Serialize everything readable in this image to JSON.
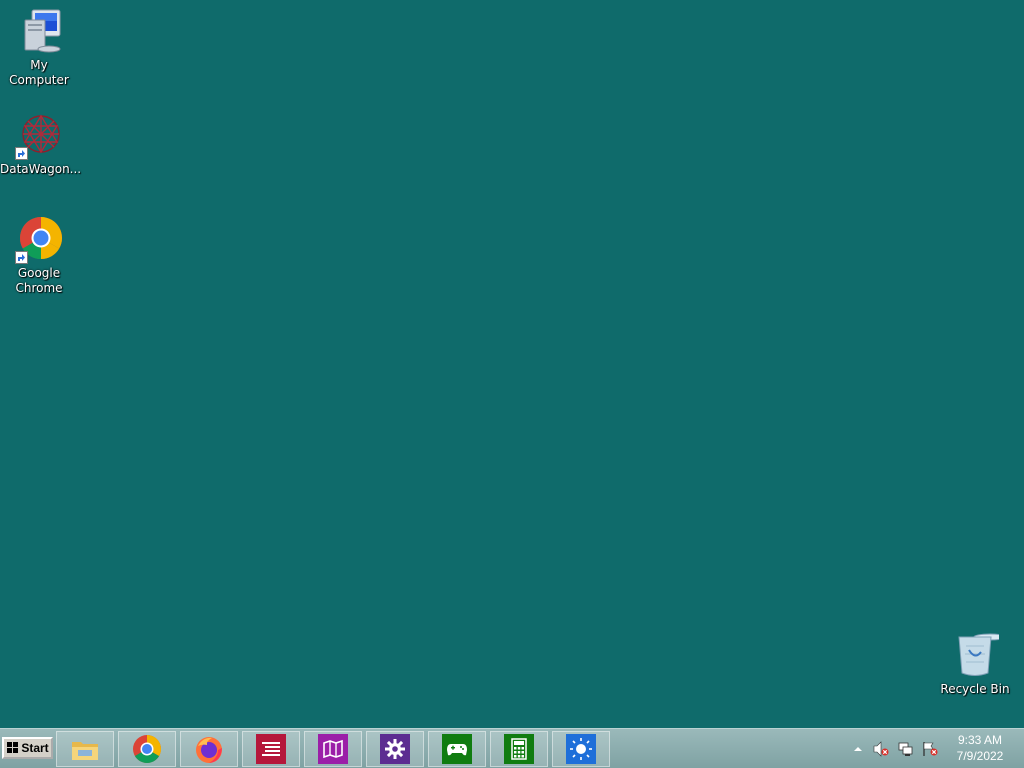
{
  "desktop": {
    "background_color": "#0f6b6b",
    "icons": [
      {
        "label": "My Computer",
        "icon": "my-computer-icon"
      },
      {
        "label": "DataWagon...",
        "icon": "datawagon-icon"
      },
      {
        "label": "Google Chrome",
        "icon": "chrome-icon"
      },
      {
        "label": "Recycle Bin",
        "icon": "recycle-bin-icon"
      }
    ]
  },
  "taskbar": {
    "start_label": "Start",
    "pinned": [
      {
        "name": "File Explorer",
        "icon": "file-explorer-icon",
        "color": "#f2c94c"
      },
      {
        "name": "Google Chrome",
        "icon": "chrome-icon",
        "color": "#4285f4"
      },
      {
        "name": "Firefox",
        "icon": "firefox-icon",
        "color": "#ff7139"
      },
      {
        "name": "Reading List",
        "icon": "reading-list-icon",
        "color": "#b5173b"
      },
      {
        "name": "Maps",
        "icon": "maps-icon",
        "color": "#9b1fa8"
      },
      {
        "name": "Settings",
        "icon": "settings-icon",
        "color": "#5c2d91"
      },
      {
        "name": "Xbox Games",
        "icon": "game-controller-icon",
        "color": "#107c10"
      },
      {
        "name": "Calculator",
        "icon": "calculator-icon",
        "color": "#107c10"
      },
      {
        "name": "Weather",
        "icon": "weather-icon",
        "color": "#1e6fd9"
      }
    ],
    "tray": {
      "icons": [
        "show-hidden-icons-icon",
        "volume-muted-icon",
        "network-icon",
        "action-center-flag-icon"
      ]
    },
    "clock": {
      "time": "9:33 AM",
      "date": "7/9/2022"
    }
  }
}
